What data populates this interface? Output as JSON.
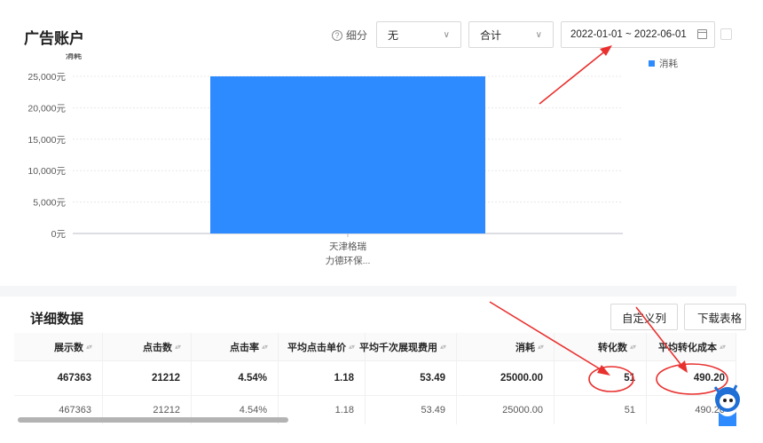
{
  "header": {
    "title": "广告账户",
    "breakdown_label": "细分",
    "breakdown_select": "无",
    "aggregate_select": "合计",
    "date_range": "2022-01-01 ~ 2022-06-01"
  },
  "colors": {
    "bar": "#2e8bff",
    "annotation_red": "#e8312f",
    "page_bg": "#ffffff",
    "gap_bg": "#f5f6f7"
  },
  "chart_data": {
    "type": "bar",
    "title": "",
    "ylabel": "消耗",
    "xlabel": "",
    "categories": [
      "天津格瑞力德环保..."
    ],
    "category_lines": [
      "天津格瑞",
      "力德环保..."
    ],
    "series": [
      {
        "name": "消耗",
        "values": [
          25000
        ]
      }
    ],
    "ylim": [
      0,
      25000
    ],
    "yticks": [
      "0元",
      "5,000元",
      "10,000元",
      "15,000元",
      "20,000元",
      "25,000元"
    ],
    "grid": true,
    "legend": "top-right"
  },
  "detail": {
    "title": "详细数据",
    "custom_columns_button": "自定义列",
    "download_button": "下载表格",
    "columns": [
      "展示数",
      "点击数",
      "点击率",
      "平均点击单价",
      "平均千次展现费用",
      "消耗",
      "转化数",
      "平均转化成本"
    ],
    "total_row": [
      "467363",
      "21212",
      "4.54%",
      "1.18",
      "53.49",
      "25000.00",
      "51",
      "490.20"
    ],
    "rows": [
      [
        "467363",
        "21212",
        "4.54%",
        "1.18",
        "53.49",
        "25000.00",
        "51",
        "490.20"
      ]
    ]
  },
  "icons": {
    "help": "help-circle-icon",
    "chevron": "chevron-down-icon",
    "calendar": "calendar-icon",
    "sort": "sort-icon"
  }
}
